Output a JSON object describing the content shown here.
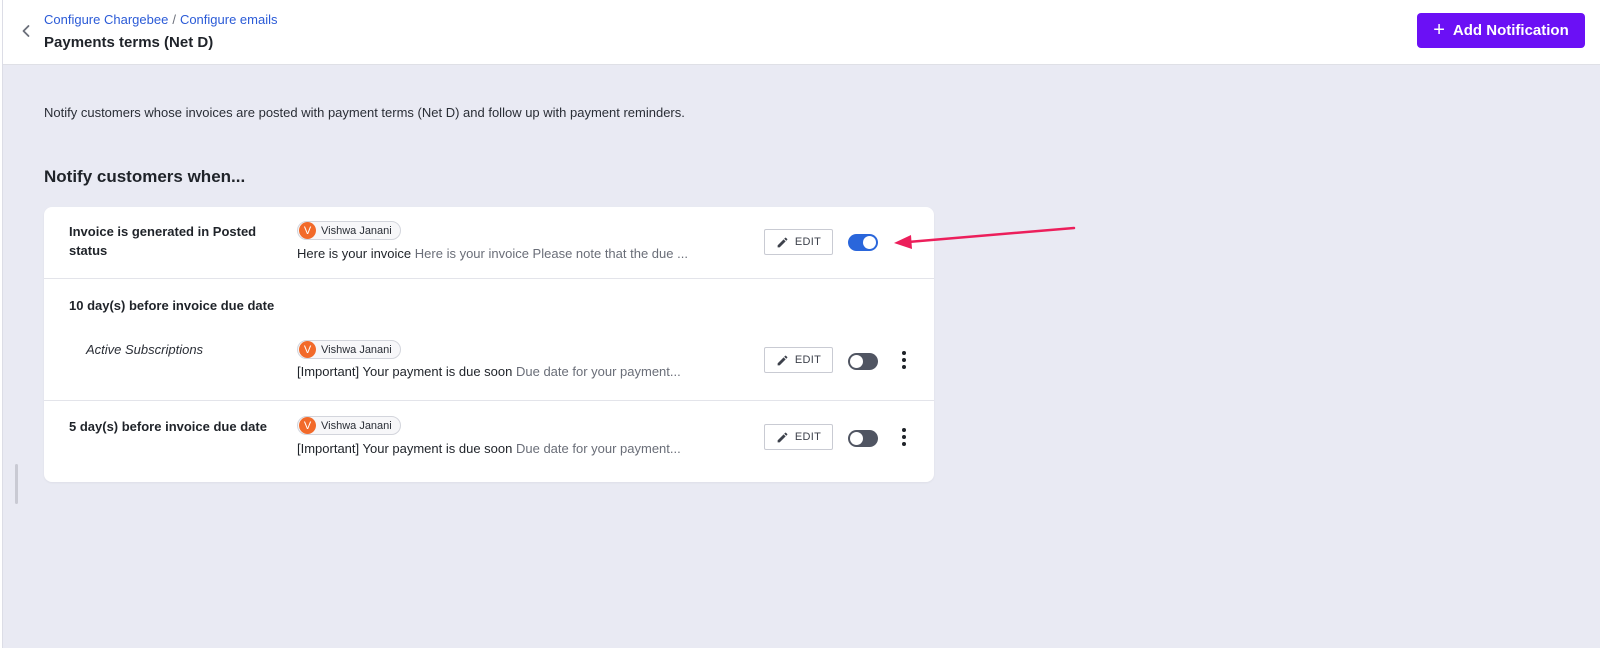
{
  "header": {
    "breadcrumb": [
      "Configure Chargebee",
      "Configure emails"
    ],
    "breadcrumb_separator": "/",
    "title": "Payments terms (Net D)",
    "add_button_label": "Add Notification",
    "add_button_icon": "plus-icon"
  },
  "main": {
    "description": "Notify customers whose invoices are posted with payment terms (Net D) and follow up with payment reminders.",
    "section_heading": "Notify customers when...",
    "rows": [
      {
        "title": "Invoice is generated in Posted status",
        "sender_initial": "V",
        "sender_name": "Vishwa Janani",
        "subject": "Here is your invoice",
        "preview": "Here is your invoice Please note that the due ...",
        "edit_label": "EDIT",
        "enabled": true
      },
      {
        "title": "10 day(s) before invoice due date",
        "subtitle": "Active Subscriptions",
        "sender_initial": "V",
        "sender_name": "Vishwa Janani",
        "subject": "[Important] Your payment is due soon",
        "preview": "Due date for your payment...",
        "edit_label": "EDIT",
        "enabled": false
      },
      {
        "title": "5 day(s) before invoice due date",
        "sender_initial": "V",
        "sender_name": "Vishwa Janani",
        "subject": "[Important] Your payment is due soon",
        "preview": "Due date for your payment...",
        "edit_label": "EDIT",
        "enabled": false
      }
    ]
  },
  "colors": {
    "accent": "#6b10f5",
    "link": "#2b5bd7",
    "toggle_on": "#2a66db",
    "toggle_off": "#505562",
    "avatar": "#f26a2a",
    "annotation_arrow": "#ec1f5b",
    "background": "#e9eaf3"
  }
}
